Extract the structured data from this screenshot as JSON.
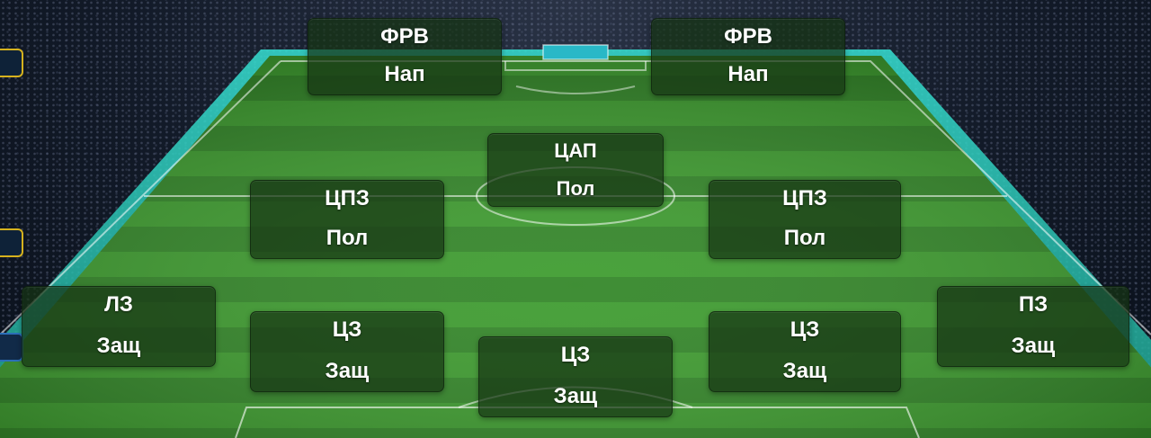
{
  "formation": {
    "positions": [
      {
        "id": "lst",
        "role": "ФРВ",
        "line": "Нап"
      },
      {
        "id": "rst",
        "role": "ФРВ",
        "line": "Нап"
      },
      {
        "id": "cam",
        "role": "ЦАП",
        "line": "Пол"
      },
      {
        "id": "lcm",
        "role": "ЦПЗ",
        "line": "Пол"
      },
      {
        "id": "rcm",
        "role": "ЦПЗ",
        "line": "Пол"
      },
      {
        "id": "lb",
        "role": "ЛЗ",
        "line": "Защ"
      },
      {
        "id": "lcb",
        "role": "ЦЗ",
        "line": "Защ"
      },
      {
        "id": "cb",
        "role": "ЦЗ",
        "line": "Защ"
      },
      {
        "id": "rcb",
        "role": "ЦЗ",
        "line": "Защ"
      },
      {
        "id": "rb",
        "role": "ПЗ",
        "line": "Защ"
      }
    ]
  },
  "colors": {
    "pitch_light": "#3f9a2e",
    "pitch_dark": "#2f7f22",
    "pitch_edge": "#2fd1c4",
    "side_tab_gold": "#d6b21e",
    "side_tab_blue": "#2b6fb8"
  }
}
